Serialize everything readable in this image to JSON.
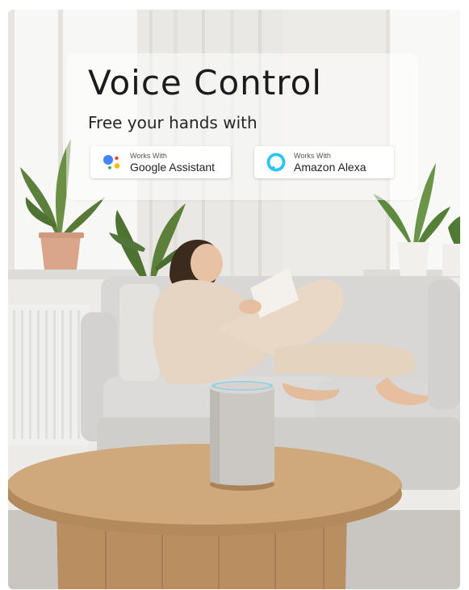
{
  "headline": {
    "title": "Voice Control",
    "subtitle": "Free your hands with"
  },
  "badges": [
    {
      "caption": "Works With",
      "name": "Google Assistant",
      "icon": "google-assistant-icon"
    },
    {
      "caption": "Works With",
      "name": "Amazon Alexa",
      "icon": "amazon-alexa-icon"
    }
  ],
  "colors": {
    "google_blue": "#4285F4",
    "google_red": "#EA4335",
    "google_yellow": "#FBBC05",
    "google_green": "#34A853",
    "alexa_cyan": "#31C4F3"
  }
}
